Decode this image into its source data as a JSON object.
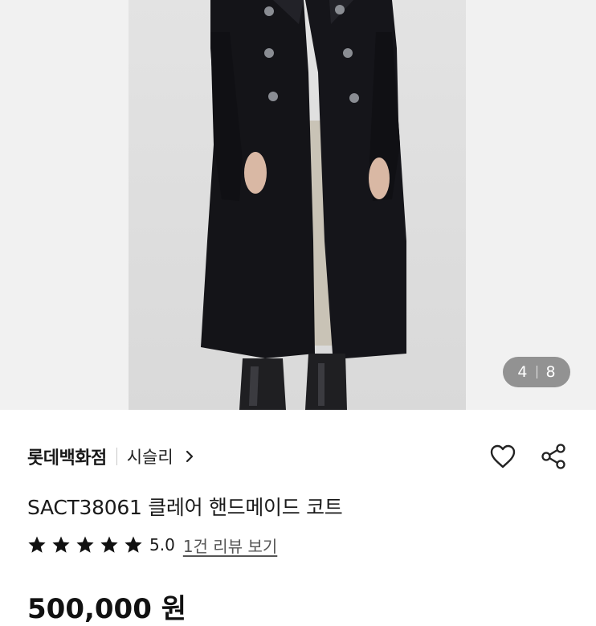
{
  "image_counter": {
    "current": "4",
    "total": "8"
  },
  "product": {
    "brand": "롯데백화점",
    "shop": "시슬리",
    "title": "SACT38061 클레어 핸드메이드 코트",
    "rating": "5.0",
    "stars": 5,
    "review_link": "1건 리뷰 보기",
    "price_partial": "500,000 원"
  },
  "icons": {
    "shop_chevron": "chevron-right-icon",
    "wishlist": "heart-icon",
    "share": "share-icon",
    "star": "star-icon"
  },
  "colors": {
    "coat": "#141418",
    "lining": "#c9c3b6",
    "counter_bg": "#6e6e6e",
    "text": "#1a1a1a"
  }
}
